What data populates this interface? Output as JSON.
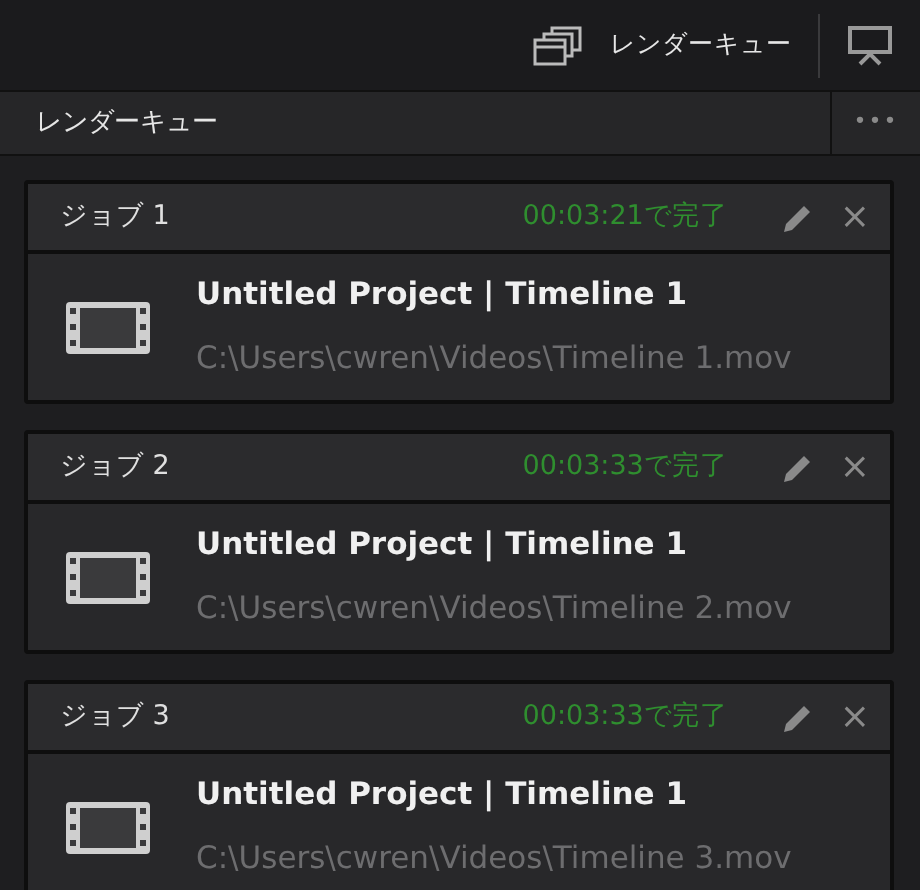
{
  "toolbar": {
    "label": "レンダーキュー"
  },
  "panel": {
    "title": "レンダーキュー",
    "menu": "•••"
  },
  "jobs": [
    {
      "name": "ジョブ 1",
      "status": "00:03:21で完了",
      "title": "Untitled Project | Timeline 1",
      "path": "C:\\Users\\cwren\\Videos\\Timeline 1.mov",
      "close": "×"
    },
    {
      "name": "ジョブ 2",
      "status": "00:03:33で完了",
      "title": "Untitled Project | Timeline 1",
      "path": "C:\\Users\\cwren\\Videos\\Timeline 2.mov",
      "close": "×"
    },
    {
      "name": "ジョブ 3",
      "status": "00:03:33で完了",
      "title": "Untitled Project | Timeline 1",
      "path": "C:\\Users\\cwren\\Videos\\Timeline 3.mov",
      "close": "×"
    }
  ]
}
